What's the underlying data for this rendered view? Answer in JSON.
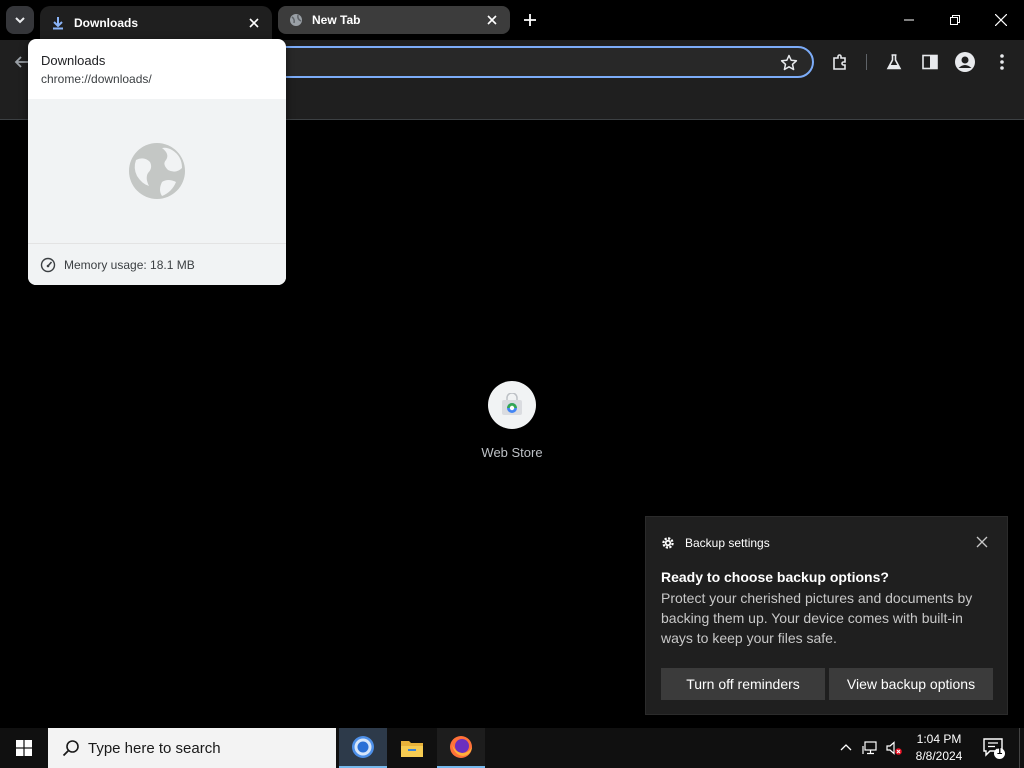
{
  "tabs": [
    {
      "title": "Downloads",
      "active": true
    },
    {
      "title": "New Tab",
      "active": false
    }
  ],
  "hover_card": {
    "title": "Downloads",
    "url": "chrome://downloads/",
    "memory": "Memory usage: 18.1 MB"
  },
  "ntp": {
    "shortcuts": [
      {
        "label": "Web Store"
      }
    ]
  },
  "toast": {
    "app": "Backup settings",
    "title": "Ready to choose backup options?",
    "body": "Protect your cherished pictures and documents by backing them up. Your device comes with built-in ways to keep your files safe.",
    "buttons": [
      "Turn off reminders",
      "View backup options"
    ]
  },
  "taskbar": {
    "search_placeholder": "Type here to search",
    "time": "1:04 PM",
    "date": "8/8/2024",
    "notification_count": "1"
  },
  "colors": {
    "accent": "#7cacf8",
    "downloads_icon": "#8ab4f8",
    "taskbar_highlight": "#76b9ed"
  },
  "icons": {
    "tab_search": "chevron-down-icon",
    "downloads_tab": "download-icon",
    "new_tab": "globe-icon",
    "extensions": "puzzle-icon",
    "labs": "flask-icon",
    "side_panel": "side-panel-icon",
    "profile": "avatar-icon",
    "menu": "kebab-icon"
  }
}
